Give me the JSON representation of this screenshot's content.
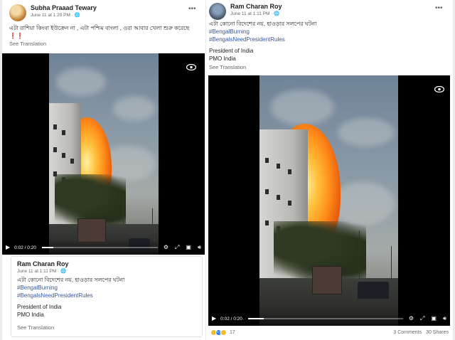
{
  "left_post": {
    "author": "Subha Praaad Tewary",
    "meta": "June 11 at 1:29 PM · ",
    "caption": "এটা রাশিয়া কিংবা ইউক্রেন না , এটা পশ্চিম বাংলা , ওরা আবার খেলা শুরু করেছে ",
    "caption_suffix": "❗❗",
    "see_translation": "See Translation",
    "video_time": "0:02 / 0:20",
    "video_progress": 0.1,
    "shared": {
      "author": "Ram Charan Roy",
      "meta": "June 11 at 1:11 PM · ",
      "caption": "এটা কোনো বিদেশের নয়, হাওড়ার সলপের ঘটনা",
      "hashtags": [
        "#BengalBurning",
        "#BengalsNeedPresidentRules"
      ],
      "lines": [
        "President of India",
        "PMO India"
      ],
      "see_translation": "See Translation"
    }
  },
  "right_post": {
    "author": "Ram Charan Roy",
    "meta": "June 11 at 1:11 PM · ",
    "caption": "এটা কোনো বিদেশের নয়, হাওড়ার সলপের ঘটনা",
    "hashtags": [
      "#BengalBurning",
      "#BengalsNeedPresidentRules"
    ],
    "lines": [
      "President of India",
      "PMO India"
    ],
    "see_translation": "See Translation",
    "video_time": "0:02 / 0:20",
    "video_progress": 0.1,
    "reaction_count": "17",
    "comments": "3 Comments",
    "shares": "30 Shares"
  },
  "icons": {
    "more": "more-dots-icon",
    "globe": "globe-icon",
    "play": "play-icon",
    "settings": "gear-icon",
    "fullscreen": "fullscreen-icon",
    "pip": "picture-in-picture-icon",
    "volume": "volume-icon",
    "views": "eye-icon"
  },
  "colors": {
    "link": "#385898",
    "muted": "#65676b",
    "exclamation": "#e02424"
  }
}
